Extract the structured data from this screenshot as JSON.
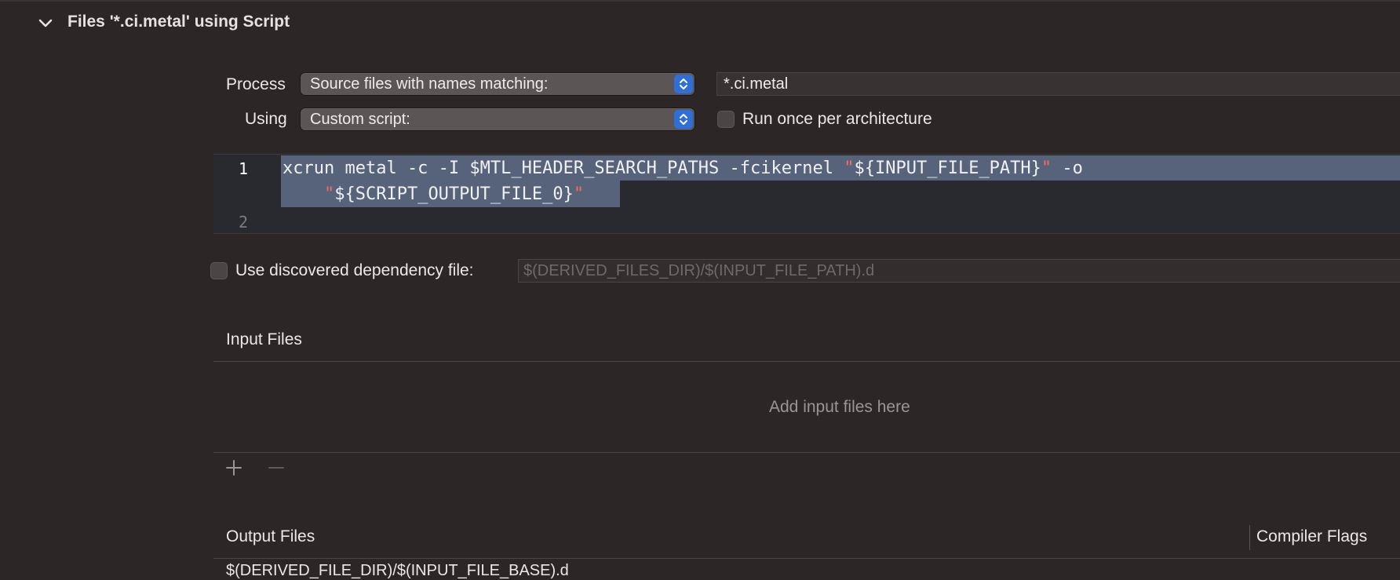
{
  "section": {
    "title": "Files '*.ci.metal' using Script"
  },
  "process": {
    "label": "Process",
    "popup_value": "Source files with names matching:",
    "pattern_value": "*.ci.metal"
  },
  "using": {
    "label": "Using",
    "popup_value": "Custom script:",
    "run_once_label": "Run once per architecture"
  },
  "script": {
    "line1_number": "1",
    "line2_number": "2",
    "line1_pre": "xcrun metal -c -I $MTL_HEADER_SEARCH_PATHS -fcikernel ",
    "line1_q1": "\"",
    "line1_var": "${INPUT_FILE_PATH}",
    "line1_q2": "\"",
    "line1_post": " -o",
    "wrap_indent": "    ",
    "wrap_q1": "\"",
    "wrap_var": "${SCRIPT_OUTPUT_FILE_0}",
    "wrap_q2": "\""
  },
  "dependency": {
    "label": "Use discovered dependency file:",
    "placeholder": "$(DERIVED_FILES_DIR)/$(INPUT_FILE_PATH).d"
  },
  "input_files": {
    "header": "Input Files",
    "empty_message": "Add input files here"
  },
  "output_files": {
    "header": "Output Files",
    "compiler_flags_header": "Compiler Flags",
    "first_row_partial": "$(DERIVED_FILE_DIR)/$(INPUT_FILE_BASE).d"
  },
  "icons": [
    "chevron-down-icon",
    "stepper-icon",
    "add-icon",
    "remove-icon"
  ],
  "colors": {
    "background": "#2c2627",
    "accent": "#2f6fd9",
    "selection": "#56637a",
    "string": "#fc6a5d"
  }
}
